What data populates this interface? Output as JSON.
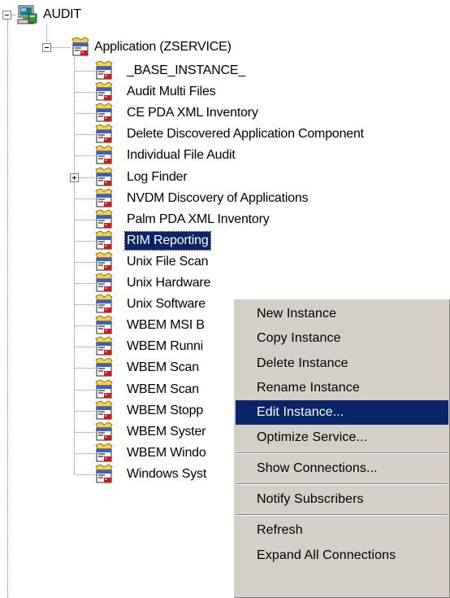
{
  "tree": {
    "root": {
      "label": "AUDIT",
      "icon": "audit-computer-icon",
      "expanded": true
    },
    "application": {
      "label": "Application (ZSERVICE)",
      "icon": "service-package-icon",
      "expanded": true
    },
    "items": [
      {
        "label": "_BASE_INSTANCE_",
        "icon": "service-instance-icon"
      },
      {
        "label": "Audit Multi Files",
        "icon": "service-instance-icon"
      },
      {
        "label": "CE PDA XML Inventory",
        "icon": "service-instance-icon"
      },
      {
        "label": "Delete Discovered Application Component",
        "icon": "service-instance-icon"
      },
      {
        "label": "Individual File Audit",
        "icon": "service-instance-icon"
      },
      {
        "label": "Log Finder",
        "icon": "service-instance-icon",
        "expandable": true
      },
      {
        "label": "NVDM Discovery of Applications",
        "icon": "service-instance-icon"
      },
      {
        "label": "Palm PDA XML Inventory",
        "icon": "service-instance-icon"
      },
      {
        "label": "RIM Reporting",
        "icon": "service-instance-icon",
        "selected": true
      },
      {
        "label": "Unix File Scan",
        "icon": "service-instance-icon"
      },
      {
        "label": "Unix Hardware",
        "icon": "service-instance-icon"
      },
      {
        "label": "Unix Software",
        "icon": "service-instance-icon"
      },
      {
        "label": "WBEM MSI B",
        "icon": "service-instance-icon"
      },
      {
        "label": "WBEM Runni",
        "icon": "service-instance-icon"
      },
      {
        "label": "WBEM Scan",
        "icon": "service-instance-icon"
      },
      {
        "label": "WBEM Scan",
        "icon": "service-instance-icon"
      },
      {
        "label": "WBEM Stopp",
        "icon": "service-instance-icon"
      },
      {
        "label": "WBEM Syster",
        "icon": "service-instance-icon"
      },
      {
        "label": "WBEM Windo",
        "icon": "service-instance-icon"
      },
      {
        "label": "Windows Syst",
        "icon": "service-instance-icon"
      }
    ]
  },
  "context_menu": {
    "groups": [
      [
        {
          "label": "New Instance"
        },
        {
          "label": "Copy Instance"
        },
        {
          "label": "Delete Instance"
        },
        {
          "label": "Rename Instance"
        },
        {
          "label": "Edit Instance...",
          "highlighted": true
        },
        {
          "label": "Optimize Service..."
        }
      ],
      [
        {
          "label": "Show Connections..."
        }
      ],
      [
        {
          "label": "Notify Subscribers"
        }
      ],
      [
        {
          "label": "Refresh"
        },
        {
          "label": "Expand All Connections"
        }
      ]
    ]
  },
  "colors": {
    "selection": "#0a246a",
    "menu_background": "#d4d0c8",
    "tree_line": "#808080"
  }
}
